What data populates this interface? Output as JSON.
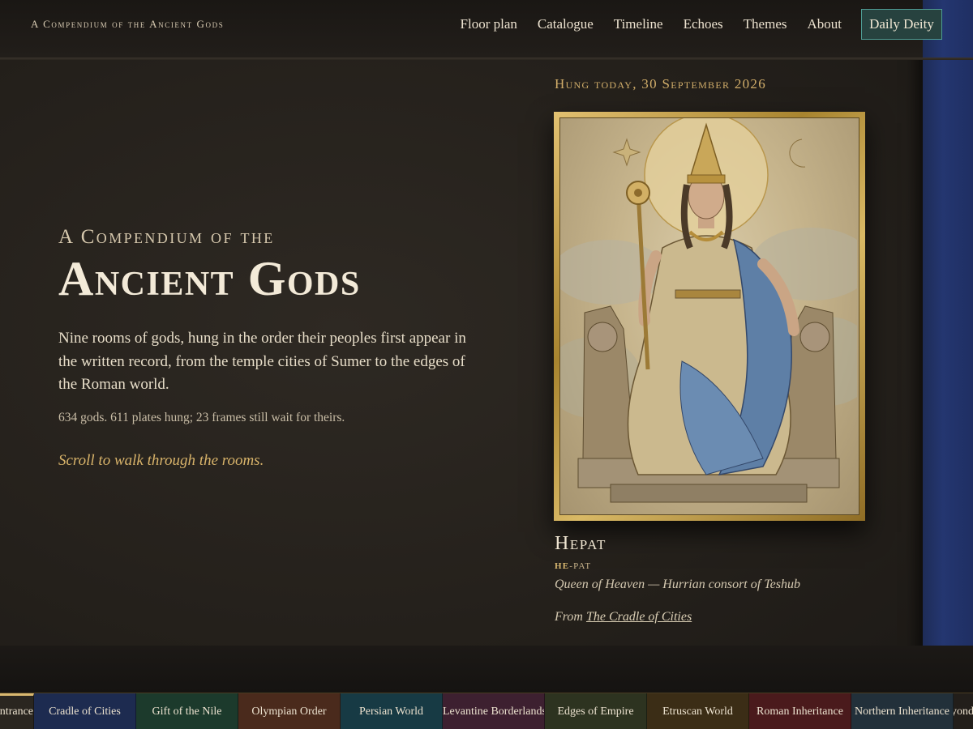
{
  "header": {
    "brand": "A Compendium of the Ancient Gods",
    "nav": [
      "Floor plan",
      "Catalogue",
      "Timeline",
      "Echoes",
      "Themes",
      "About"
    ],
    "cta": "Daily Deity"
  },
  "hero": {
    "kicker": "A Compendium of the",
    "title": "Ancient Gods",
    "body": "Nine rooms of gods, hung in the order their peoples first appear in the written record, from the temple cities of Sumer to the edges of the Roman world.",
    "stats": "634 gods. 611 plates hung; 23 frames still wait for theirs.",
    "scroll_hint": "Scroll to walk through the rooms."
  },
  "featured": {
    "hung_label": "Hung today, 30 September 2026",
    "name": "Hepat",
    "pron_stressed": "HE",
    "pron_rest": "-PAT",
    "epithet": "Queen of Heaven — Hurrian consort of Teshub",
    "from_prefix": "From",
    "from_link": "The Cradle of Cities",
    "plate_icon": "enthroned-goddess-engraving"
  },
  "rooms": [
    {
      "label": "Entrance",
      "color": "#2a2620"
    },
    {
      "label": "Cradle of Cities",
      "color": "#1d2b50"
    },
    {
      "label": "Gift of the Nile",
      "color": "#1c3a2c"
    },
    {
      "label": "Olympian Order",
      "color": "#4a2a1c"
    },
    {
      "label": "Persian World",
      "color": "#173a44"
    },
    {
      "label": "Levantine Borderlands",
      "color": "#3d2030"
    },
    {
      "label": "Edges of Empire",
      "color": "#2d3320"
    },
    {
      "label": "Etruscan World",
      "color": "#3b2d16"
    },
    {
      "label": "Roman Inheritance",
      "color": "#4a1a1c"
    },
    {
      "label": "Northern Inheritance",
      "color": "#22303a"
    },
    {
      "label": "Beyond",
      "color": "#221e1a"
    }
  ],
  "colors": {
    "accent_gold": "#d9b870",
    "cta_teal": "#27423f",
    "panel_blue": "#243670"
  }
}
